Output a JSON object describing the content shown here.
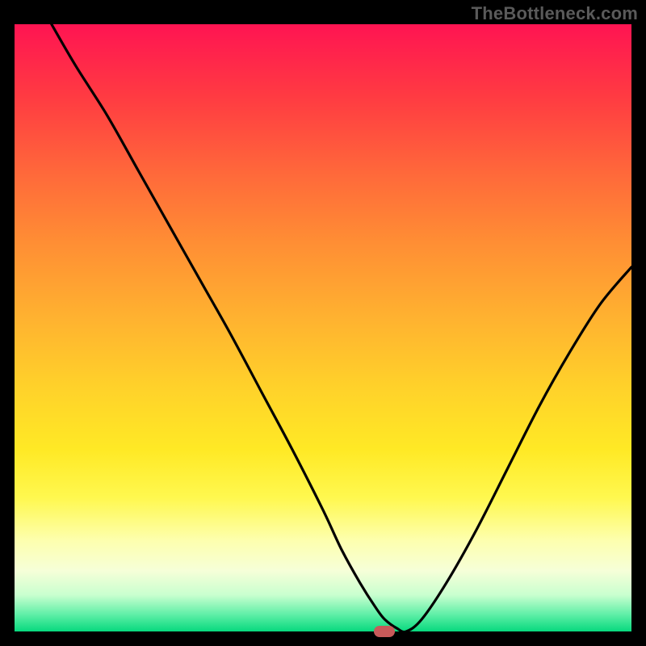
{
  "watermark": "TheBottleneck.com",
  "chart_data": {
    "type": "line",
    "title": "",
    "xlabel": "",
    "ylabel": "",
    "xlim": [
      0,
      100
    ],
    "ylim": [
      0,
      100
    ],
    "x": [
      6,
      10,
      15,
      20,
      25,
      30,
      35,
      40,
      45,
      50,
      53,
      56,
      58.5,
      60,
      62,
      63.5,
      66,
      70,
      75,
      80,
      85,
      90,
      95,
      100
    ],
    "y": [
      100,
      93,
      85,
      76,
      67,
      58,
      49,
      39.5,
      30,
      20,
      13.5,
      8,
      4,
      2,
      0.5,
      0,
      2,
      8,
      17,
      27,
      37,
      46,
      54,
      60
    ],
    "flat_segment": {
      "x_range": [
        56,
        63.5
      ],
      "y": 0
    },
    "marker": {
      "x": 60,
      "y": 0,
      "shape": "rounded-rect",
      "color": "#c85a5a"
    },
    "background": "vertical gradient red→orange→yellow→light-green→green"
  },
  "colors": {
    "frame": "#000000",
    "curve": "#000000",
    "marker": "#c85a5a",
    "watermark": "#5a5a5a"
  }
}
